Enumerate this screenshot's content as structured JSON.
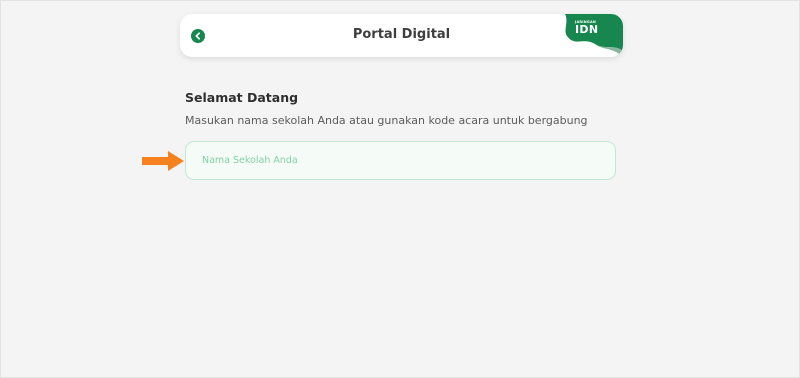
{
  "header": {
    "title": "Portal Digital",
    "back_icon": "chevron-left-icon",
    "brand": {
      "small_text": "JARINGAN",
      "big_text": "IDN",
      "color": "#17874f"
    }
  },
  "main": {
    "title": "Selamat Datang",
    "subtitle": "Masukan nama sekolah Anda atau gunakan kode acara untuk bergabung",
    "search": {
      "placeholder": "Nama Sekolah Anda",
      "value": ""
    }
  },
  "annotation": {
    "arrow_icon": "arrow-right-icon",
    "color": "#f5821f"
  },
  "colors": {
    "background": "#f3f4f3",
    "accent": "#17874f",
    "input_border": "#c5e6d3",
    "input_placeholder": "#84cfa6"
  }
}
